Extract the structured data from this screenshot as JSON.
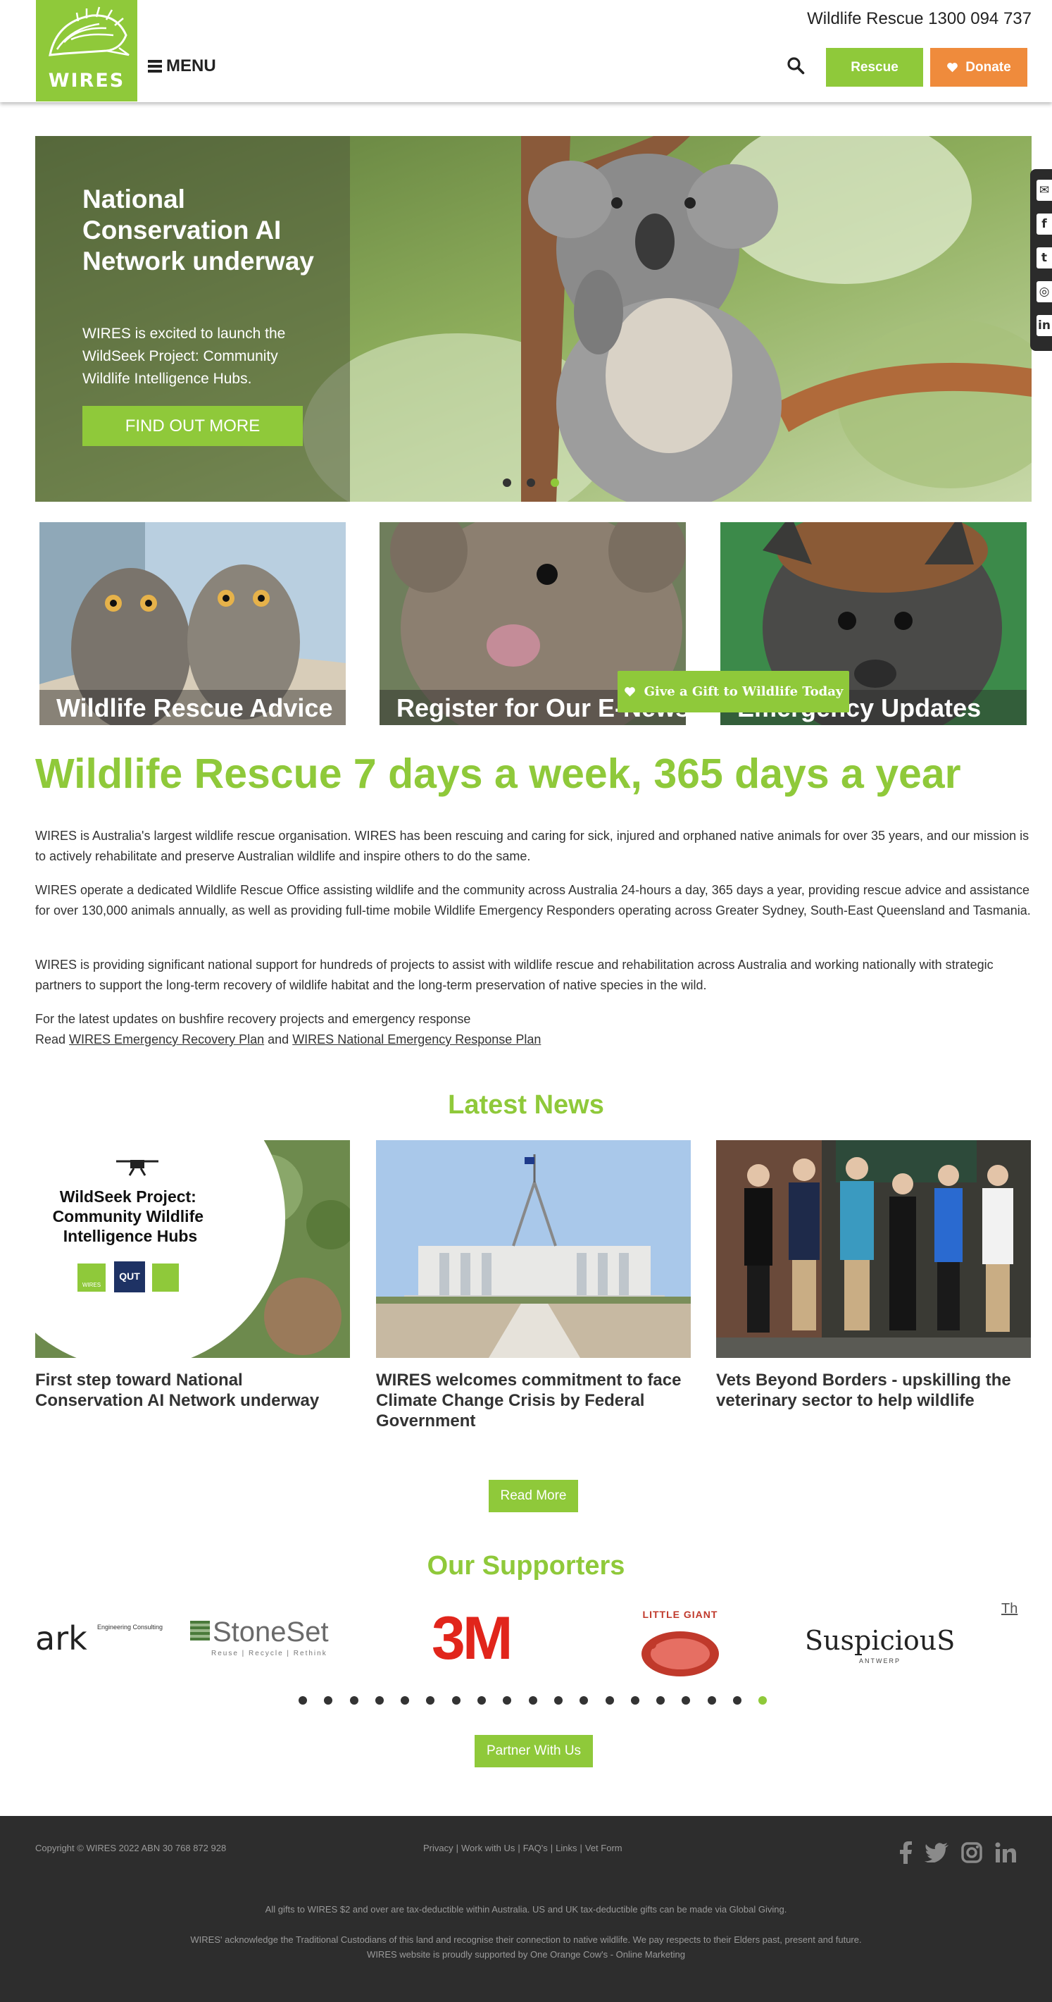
{
  "header": {
    "logo_text": "WIRES",
    "menu_label": "MENU",
    "phone": "Wildlife Rescue 1300 094 737",
    "rescue_label": "Rescue",
    "donate_label": "Donate"
  },
  "hero": {
    "title": "National Conservation AI Network underway",
    "text": "WIRES is excited to launch the WildSeek Project: Community Wildlife Intelligence Hubs.",
    "button": "FIND OUT MORE",
    "slides": 3,
    "active_slide": 3
  },
  "social_side": [
    "email-icon",
    "facebook-icon",
    "twitter-icon",
    "instagram-icon",
    "linkedin-icon"
  ],
  "tiles": [
    {
      "label": "Wildlife Rescue Advice"
    },
    {
      "label": "Register for Our E-News"
    },
    {
      "label": "Emergency Updates"
    }
  ],
  "gift_button": "Give a Gift to Wildlife Today",
  "intro": {
    "heading": "Wildlife Rescue 7 days a week, 365 days a year",
    "p1": "WIRES is Australia's largest wildlife rescue organisation. WIRES has been rescuing and caring for sick, injured and orphaned native animals for over 35 years, and our mission is to actively rehabilitate and preserve Australian wildlife and inspire others to do the same.",
    "p2": "WIRES operate a dedicated Wildlife Rescue Office assisting wildlife and the community across Australia 24-hours a day, 365 days a year, providing rescue advice and assistance for over 130,000 animals annually, as well as providing full-time mobile Wildlife Emergency Responders operating across Greater Sydney, South-East Queensland and Tasmania.",
    "p3": "WIRES is providing significant national support for hundreds of projects to assist with wildlife rescue and rehabilitation across Australia and working nationally with strategic partners to support the long-term recovery of wildlife habitat and the long-term preservation of native species in the wild.",
    "p4_line1": "For the latest updates on bushfire recovery projects and emergency response",
    "p4_read": "Read ",
    "p4_link1": "WIRES Emergency Recovery Plan",
    "p4_and": " and ",
    "p4_link2": "WIRES National Emergency Response Plan"
  },
  "news": {
    "title": "Latest News",
    "items": [
      {
        "title": "First step toward National Conservation AI Network underway",
        "image_heading": "WildSeek Project: Community Wildlife Intelligence Hubs",
        "logo1": "WIRES",
        "logo2": "QUT"
      },
      {
        "title": "WIRES welcomes commitment to face Climate Change Crisis by Federal Government"
      },
      {
        "title": "Vets Beyond Borders - upskilling the veterinary sector to help wildlife"
      }
    ],
    "read_more": "Read More"
  },
  "supporters": {
    "title": "Our Supporters",
    "logos": [
      {
        "name": "ark",
        "sub": "Engineering Consulting"
      },
      {
        "name": "StoneSet",
        "sub": "Reuse | Recycle | Rethink"
      },
      {
        "name": "3M"
      },
      {
        "name": "LITTLE GIANT"
      },
      {
        "name": "SuspiciouS",
        "sub": "ANTWERP"
      },
      {
        "name": "Th"
      }
    ],
    "dot_count": 19,
    "active_dot": 19,
    "partner_button": "Partner With Us"
  },
  "footer": {
    "copyright": "Copyright © WIRES 2022 ABN 30 768 872 928",
    "links": [
      "Privacy",
      "Work with Us",
      "FAQ's",
      "Links",
      "Vet Form"
    ],
    "tax_note": "All gifts to WIRES $2 and over are tax-deductible within Australia. US and UK tax-deductible gifts can be made via Global Giving.",
    "acknowledgement": "WIRES' acknowledge the Traditional Custodians of this land and recognise their connection to native wildlife. We pay respects to their Elders past, present and future.",
    "support": "WIRES website is proudly supported by One Orange Cow's - Online Marketing",
    "social": [
      "facebook-icon",
      "twitter-icon",
      "instagram-icon",
      "linkedin-icon"
    ]
  },
  "colors": {
    "brand_green": "#8fc93a",
    "donate_orange": "#ef8b3c",
    "footer_bg": "#2d2d2d"
  }
}
